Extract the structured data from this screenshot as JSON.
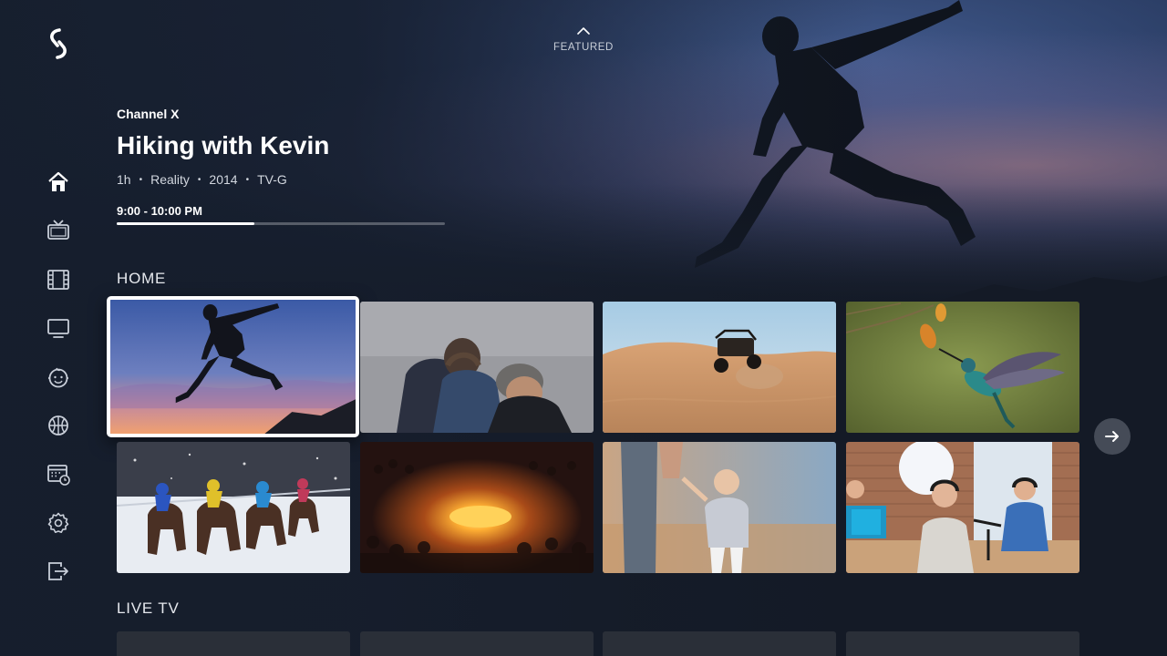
{
  "featured": {
    "label": "FEATURED"
  },
  "hero": {
    "channel": "Channel X",
    "title": "Hiking with Kevin",
    "meta": [
      "1h",
      "Reality",
      "2014",
      "TV-G"
    ],
    "time_range": "9:00 - 10:00 PM",
    "progress": 0.42
  },
  "sidebar": {
    "items": [
      {
        "icon": "home-icon",
        "active": true
      },
      {
        "icon": "tv-icon"
      },
      {
        "icon": "film-icon"
      },
      {
        "icon": "monitor-icon"
      },
      {
        "icon": "kids-icon"
      },
      {
        "icon": "sports-ball-icon"
      },
      {
        "icon": "schedule-icon"
      },
      {
        "icon": "settings-icon"
      },
      {
        "icon": "exit-icon"
      }
    ]
  },
  "sections": {
    "home": {
      "title": "HOME",
      "tiles": [
        {
          "subject": "jumping silhouette at sunset",
          "focused": true
        },
        {
          "subject": "two people in gray studio"
        },
        {
          "subject": "dune buggy in desert"
        },
        {
          "subject": "hummingbird at flower"
        },
        {
          "subject": "horse race in snow"
        },
        {
          "subject": "crowd around bonfire"
        },
        {
          "subject": "child walking with parent"
        },
        {
          "subject": "podcast studio"
        }
      ]
    },
    "live_tv": {
      "title": "LIVE TV"
    }
  },
  "colors": {
    "background": "#141a26",
    "accent": "#ffffff",
    "muted_text": "#d2d7df"
  }
}
